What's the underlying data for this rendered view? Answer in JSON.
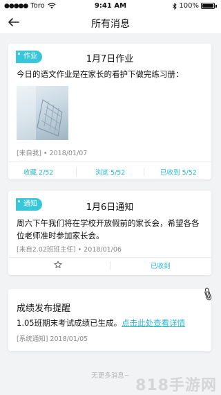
{
  "status_bar": {
    "carrier": "Toro",
    "time": "9:41 AM",
    "battery": "100%"
  },
  "nav": {
    "title": "所有消息"
  },
  "messages": [
    {
      "tag": "作业",
      "title": "1月7日作业",
      "body": "今日的语文作业是在家长的看护下做完练习册：",
      "meta": "[来自我] • 2018/01/07",
      "actions": {
        "collect": "收藏  2/52",
        "viewed": "浏览  5/52",
        "received": "已收到  5/52"
      }
    },
    {
      "tag": "通知",
      "title": "1月6日通知",
      "body": "周六下午我们将在学校开放假前的家长会，希望各各位老师准时参加家长会。",
      "meta": "[来自2.02班班主任] • 2018/01/06",
      "actions": {
        "received": "已收到"
      }
    },
    {
      "title": "成绩发布提醒",
      "body_prefix": "1.05班期末考试成绩已生成。",
      "body_link": "点击此处查看详情",
      "meta": "[系统通知]   2018/01/05"
    }
  ],
  "footer_note": "无更多消息~",
  "watermark": "818手游网",
  "colors": {
    "accent": "#38c6d9",
    "link": "#2bb7cf"
  }
}
